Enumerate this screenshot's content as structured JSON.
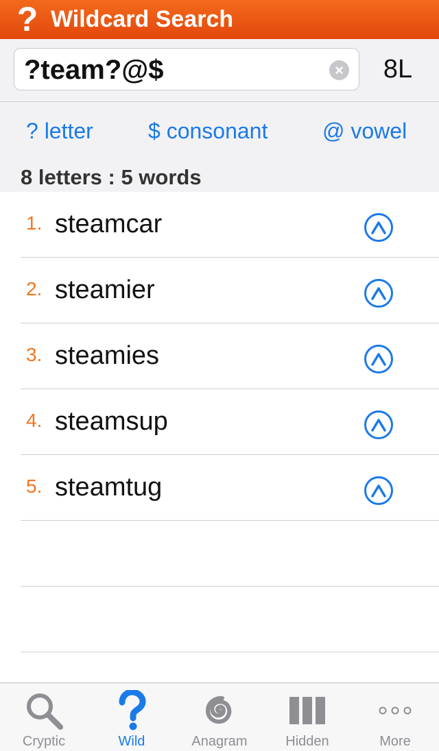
{
  "header": {
    "icon_glyph": "?",
    "title": "Wildcard Search"
  },
  "search": {
    "value": "?team?@$",
    "length_label": "8L"
  },
  "legend": {
    "letter": "? letter",
    "consonant": "$ consonant",
    "vowel": "@ vowel"
  },
  "summary": "8 letters : 5 words",
  "results": [
    {
      "num": "1.",
      "word": "steamcar"
    },
    {
      "num": "2.",
      "word": "steamier"
    },
    {
      "num": "3.",
      "word": "steamies"
    },
    {
      "num": "4.",
      "word": "steamsup"
    },
    {
      "num": "5.",
      "word": "steamtug"
    }
  ],
  "tabs": [
    {
      "label": "Cryptic",
      "icon": "search-icon",
      "active": false
    },
    {
      "label": "Wild",
      "icon": "question-icon",
      "active": true
    },
    {
      "label": "Anagram",
      "icon": "spiral-icon",
      "active": false
    },
    {
      "label": "Hidden",
      "icon": "columns-icon",
      "active": false
    },
    {
      "label": "More",
      "icon": "more-icon",
      "active": false
    }
  ],
  "colors": {
    "header": "#e8500f",
    "accent": "#1a7ae8",
    "number": "#f0751f",
    "inactive_tab": "#8e8e93"
  }
}
